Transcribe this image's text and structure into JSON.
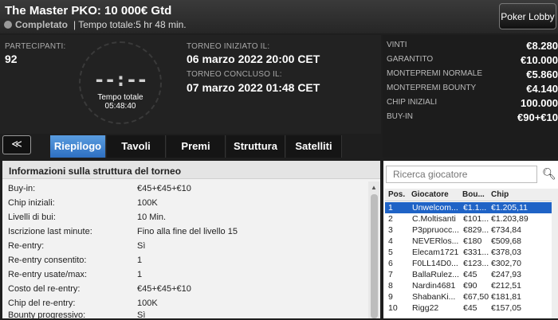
{
  "header": {
    "title": "The Master PKO: 10 000€ Gtd",
    "status": "Completato",
    "total_time": "| Tempo totale:5 hr 48 min.",
    "lobby_button": "Poker Lobby"
  },
  "info": {
    "participants_label": "PARTECIPANTI:",
    "participants_value": "92",
    "clock_digits": "--:--",
    "clock_label": "Tempo totale",
    "clock_value": "05:48:40",
    "started_label": "TORNEO INIZIATO IL:",
    "started_value": "06 marzo 2022  20:00 CET",
    "ended_label": "TORNEO CONCLUSO IL:",
    "ended_value": "07 marzo 2022  01:48 CET"
  },
  "stats": [
    {
      "label": "VINTI",
      "value": "€8.280"
    },
    {
      "label": "GARANTITO",
      "value": "€10.000"
    },
    {
      "label": "MONTEPREMI NORMALE",
      "value": "€5.860"
    },
    {
      "label": "MONTEPREMI BOUNTY",
      "value": "€4.140"
    },
    {
      "label": "CHIP INIZIALI",
      "value": "100.000"
    },
    {
      "label": "BUY-IN",
      "value": "€90+€10"
    }
  ],
  "collapse_glyph": "≪",
  "tabs": [
    "Riepilogo",
    "Tavoli",
    "Premi",
    "Struttura",
    "Satelliti"
  ],
  "structure": {
    "header": "Informazioni sulla struttura del torneo",
    "rows": [
      {
        "label": "Buy-in:",
        "value": "€45+€45+€10"
      },
      {
        "label": "Chip iniziali:",
        "value": "100K"
      },
      {
        "label": "Livelli di bui:",
        "value": "10 Min."
      },
      {
        "label": "Iscrizione last minute:",
        "value": "Fino alla fine del livello 15"
      },
      {
        "label": "Re-entry:",
        "value": "Sì"
      },
      {
        "label": "Re-entry consentito:",
        "value": "1"
      },
      {
        "label": "Re-entry usate/max:",
        "value": "1"
      },
      {
        "label": "Costo del re-entry:",
        "value": "€45+€45+€10"
      },
      {
        "label": "Chip del re-entry:",
        "value": "100K"
      },
      {
        "label": "Bounty progressivo:",
        "value": "Sì"
      }
    ]
  },
  "players": {
    "search_placeholder": "Ricerca giocatore",
    "columns": [
      "Pos.",
      "Giocatore",
      "Bou...",
      "Chip"
    ],
    "rows": [
      {
        "pos": "1",
        "name": "Unwelcom...",
        "bounty": "€1.1...",
        "chip": "€1.205,11"
      },
      {
        "pos": "2",
        "name": "C.Moltisanti",
        "bounty": "€101...",
        "chip": "€1.203,89"
      },
      {
        "pos": "3",
        "name": "P3ppruocc...",
        "bounty": "€829...",
        "chip": "€734,84"
      },
      {
        "pos": "4",
        "name": "NEVERlos...",
        "bounty": "€180",
        "chip": "€509,68"
      },
      {
        "pos": "5",
        "name": "Elecam1721",
        "bounty": "€331...",
        "chip": "€378,03"
      },
      {
        "pos": "6",
        "name": "F0LL14D0...",
        "bounty": "€123...",
        "chip": "€302,70"
      },
      {
        "pos": "7",
        "name": "BallaRulez...",
        "bounty": "€45",
        "chip": "€247,93"
      },
      {
        "pos": "8",
        "name": "Nardin4681",
        "bounty": "€90",
        "chip": "€212,51"
      },
      {
        "pos": "9",
        "name": "ShabanKi...",
        "bounty": "€67,50",
        "chip": "€181,81"
      },
      {
        "pos": "10",
        "name": "Rigg22",
        "bounty": "€45",
        "chip": "€157,05"
      }
    ]
  }
}
